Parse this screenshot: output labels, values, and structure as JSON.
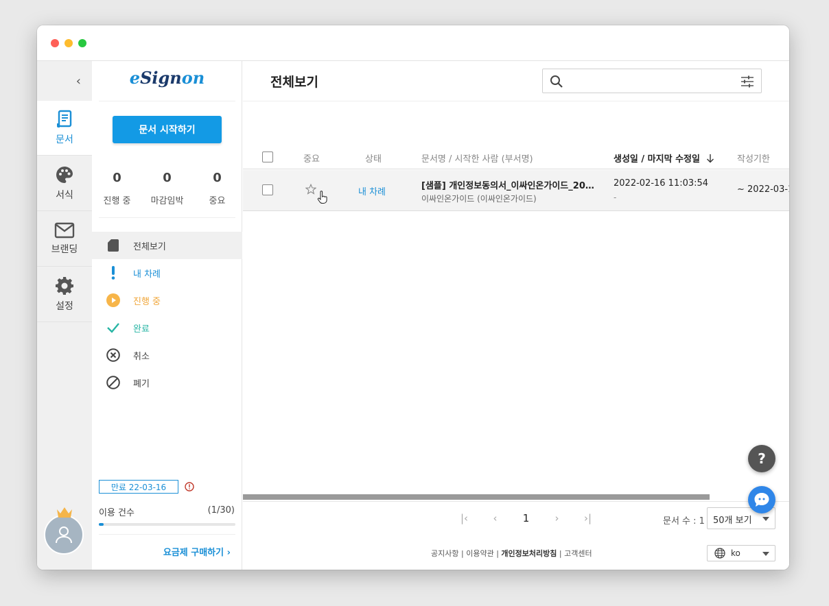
{
  "app": {
    "logo_e": "e",
    "logo_sign": "Sign",
    "logo_on": "on"
  },
  "rail": {
    "collapse_glyph": "‹",
    "items": [
      {
        "label": "문서",
        "icon": "document-icon",
        "active": true
      },
      {
        "label": "서식",
        "icon": "palette-icon",
        "active": false
      },
      {
        "label": "브랜딩",
        "icon": "mail-icon",
        "active": false
      },
      {
        "label": "설정",
        "icon": "gear-icon",
        "active": false
      }
    ]
  },
  "sidebar": {
    "start_button": "문서 시작하기",
    "stats": [
      {
        "value": "0",
        "label": "진행 중"
      },
      {
        "value": "0",
        "label": "마감임박"
      },
      {
        "value": "0",
        "label": "중요"
      }
    ],
    "menu": [
      {
        "label": "전체보기",
        "icon": "document-fill-icon"
      },
      {
        "label": "내 차례",
        "icon": "exclamation-icon"
      },
      {
        "label": "진행 중",
        "icon": "play-circle-icon"
      },
      {
        "label": "완료",
        "icon": "check-icon"
      },
      {
        "label": "취소",
        "icon": "cancel-circle-icon"
      },
      {
        "label": "폐기",
        "icon": "ban-icon"
      }
    ],
    "expiry": "만료 22-03-16",
    "usage_label": "이용 건수",
    "usage_count": "(1/30)",
    "usage_fraction": 0.033,
    "upgrade": "요금제 구매하기"
  },
  "main": {
    "title": "전체보기",
    "search": {
      "placeholder": "",
      "value": ""
    },
    "columns": {
      "important": "중요",
      "status": "상태",
      "doc": "문서명 / 시작한 사람 (부서명)",
      "created": "생성일 / 마지막 수정일",
      "deadline": "작성기한"
    },
    "rows": [
      {
        "status": "내 차례",
        "title": "[샘플] 개인정보동의서_이싸인온가이드_20…",
        "starter": "이싸인온가이드 (이싸인온가이드)",
        "created": "2022-02-16 11:03:54",
        "modified": "-",
        "deadline": "~ 2022-03-1"
      }
    ],
    "pager": {
      "first": "|‹",
      "prev": "‹",
      "current": "1",
      "next": "›",
      "last": "›|"
    },
    "doc_count": "문서 수 : 1",
    "per_page": "50개 보기",
    "footer_links": {
      "notice": "공지사항",
      "terms": "이용약관",
      "privacy": "개인정보처리방침",
      "support": "고객센터",
      "sep": "|"
    },
    "language": "ko",
    "help_glyph": "?"
  },
  "colors": {
    "accent": "#1a8fd6",
    "button": "#139ae5",
    "orange": "#f0a63a",
    "teal": "#27b5a4"
  }
}
